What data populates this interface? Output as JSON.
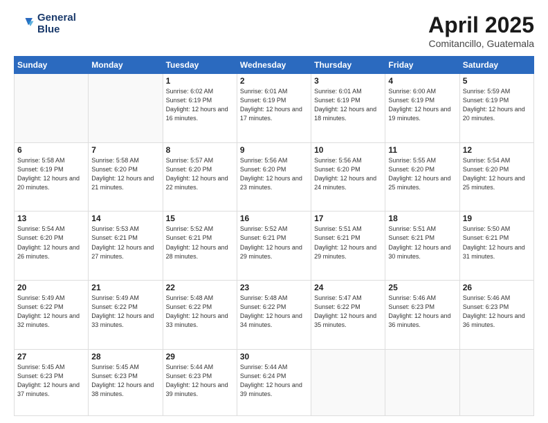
{
  "header": {
    "logo_line1": "General",
    "logo_line2": "Blue",
    "month_year": "April 2025",
    "location": "Comitancillo, Guatemala"
  },
  "weekdays": [
    "Sunday",
    "Monday",
    "Tuesday",
    "Wednesday",
    "Thursday",
    "Friday",
    "Saturday"
  ],
  "weeks": [
    [
      {
        "day": "",
        "info": ""
      },
      {
        "day": "",
        "info": ""
      },
      {
        "day": "1",
        "info": "Sunrise: 6:02 AM\nSunset: 6:19 PM\nDaylight: 12 hours and 16 minutes."
      },
      {
        "day": "2",
        "info": "Sunrise: 6:01 AM\nSunset: 6:19 PM\nDaylight: 12 hours and 17 minutes."
      },
      {
        "day": "3",
        "info": "Sunrise: 6:01 AM\nSunset: 6:19 PM\nDaylight: 12 hours and 18 minutes."
      },
      {
        "day": "4",
        "info": "Sunrise: 6:00 AM\nSunset: 6:19 PM\nDaylight: 12 hours and 19 minutes."
      },
      {
        "day": "5",
        "info": "Sunrise: 5:59 AM\nSunset: 6:19 PM\nDaylight: 12 hours and 20 minutes."
      }
    ],
    [
      {
        "day": "6",
        "info": "Sunrise: 5:58 AM\nSunset: 6:19 PM\nDaylight: 12 hours and 20 minutes."
      },
      {
        "day": "7",
        "info": "Sunrise: 5:58 AM\nSunset: 6:20 PM\nDaylight: 12 hours and 21 minutes."
      },
      {
        "day": "8",
        "info": "Sunrise: 5:57 AM\nSunset: 6:20 PM\nDaylight: 12 hours and 22 minutes."
      },
      {
        "day": "9",
        "info": "Sunrise: 5:56 AM\nSunset: 6:20 PM\nDaylight: 12 hours and 23 minutes."
      },
      {
        "day": "10",
        "info": "Sunrise: 5:56 AM\nSunset: 6:20 PM\nDaylight: 12 hours and 24 minutes."
      },
      {
        "day": "11",
        "info": "Sunrise: 5:55 AM\nSunset: 6:20 PM\nDaylight: 12 hours and 25 minutes."
      },
      {
        "day": "12",
        "info": "Sunrise: 5:54 AM\nSunset: 6:20 PM\nDaylight: 12 hours and 25 minutes."
      }
    ],
    [
      {
        "day": "13",
        "info": "Sunrise: 5:54 AM\nSunset: 6:20 PM\nDaylight: 12 hours and 26 minutes."
      },
      {
        "day": "14",
        "info": "Sunrise: 5:53 AM\nSunset: 6:21 PM\nDaylight: 12 hours and 27 minutes."
      },
      {
        "day": "15",
        "info": "Sunrise: 5:52 AM\nSunset: 6:21 PM\nDaylight: 12 hours and 28 minutes."
      },
      {
        "day": "16",
        "info": "Sunrise: 5:52 AM\nSunset: 6:21 PM\nDaylight: 12 hours and 29 minutes."
      },
      {
        "day": "17",
        "info": "Sunrise: 5:51 AM\nSunset: 6:21 PM\nDaylight: 12 hours and 29 minutes."
      },
      {
        "day": "18",
        "info": "Sunrise: 5:51 AM\nSunset: 6:21 PM\nDaylight: 12 hours and 30 minutes."
      },
      {
        "day": "19",
        "info": "Sunrise: 5:50 AM\nSunset: 6:21 PM\nDaylight: 12 hours and 31 minutes."
      }
    ],
    [
      {
        "day": "20",
        "info": "Sunrise: 5:49 AM\nSunset: 6:22 PM\nDaylight: 12 hours and 32 minutes."
      },
      {
        "day": "21",
        "info": "Sunrise: 5:49 AM\nSunset: 6:22 PM\nDaylight: 12 hours and 33 minutes."
      },
      {
        "day": "22",
        "info": "Sunrise: 5:48 AM\nSunset: 6:22 PM\nDaylight: 12 hours and 33 minutes."
      },
      {
        "day": "23",
        "info": "Sunrise: 5:48 AM\nSunset: 6:22 PM\nDaylight: 12 hours and 34 minutes."
      },
      {
        "day": "24",
        "info": "Sunrise: 5:47 AM\nSunset: 6:22 PM\nDaylight: 12 hours and 35 minutes."
      },
      {
        "day": "25",
        "info": "Sunrise: 5:46 AM\nSunset: 6:23 PM\nDaylight: 12 hours and 36 minutes."
      },
      {
        "day": "26",
        "info": "Sunrise: 5:46 AM\nSunset: 6:23 PM\nDaylight: 12 hours and 36 minutes."
      }
    ],
    [
      {
        "day": "27",
        "info": "Sunrise: 5:45 AM\nSunset: 6:23 PM\nDaylight: 12 hours and 37 minutes."
      },
      {
        "day": "28",
        "info": "Sunrise: 5:45 AM\nSunset: 6:23 PM\nDaylight: 12 hours and 38 minutes."
      },
      {
        "day": "29",
        "info": "Sunrise: 5:44 AM\nSunset: 6:23 PM\nDaylight: 12 hours and 39 minutes."
      },
      {
        "day": "30",
        "info": "Sunrise: 5:44 AM\nSunset: 6:24 PM\nDaylight: 12 hours and 39 minutes."
      },
      {
        "day": "",
        "info": ""
      },
      {
        "day": "",
        "info": ""
      },
      {
        "day": "",
        "info": ""
      }
    ]
  ]
}
